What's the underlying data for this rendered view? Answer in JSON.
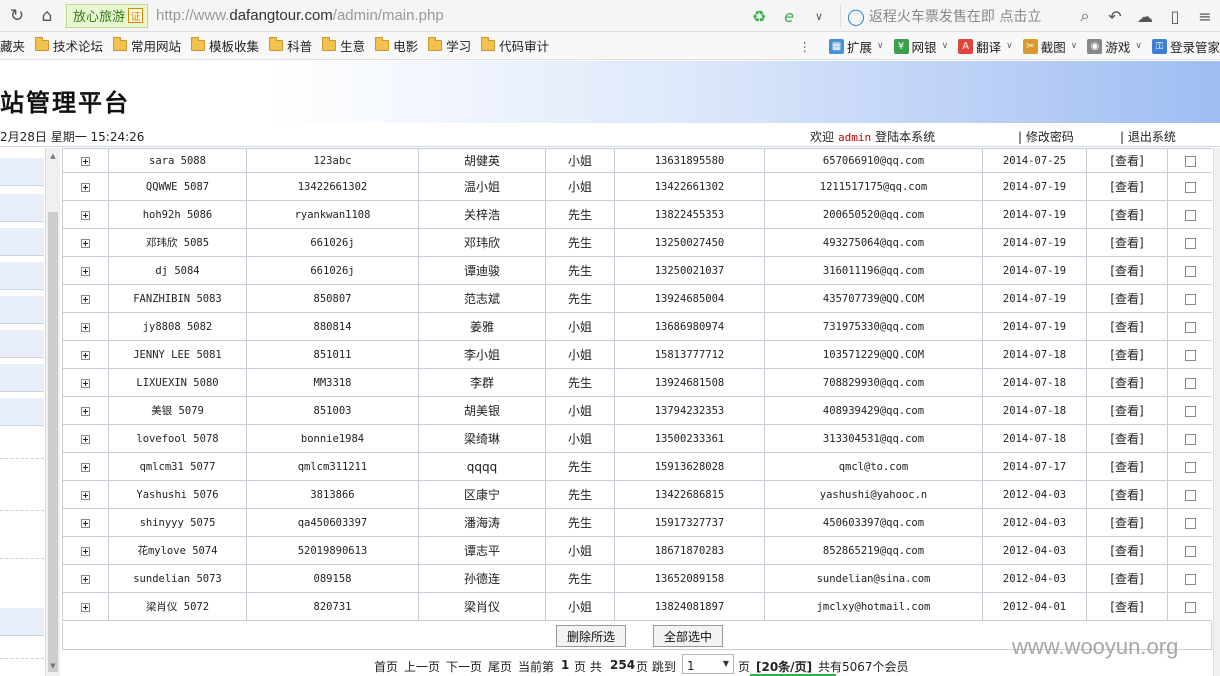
{
  "browser": {
    "site_badge": "放心旅游",
    "cert_mark": "证",
    "url_scheme": "http://www.",
    "url_host": "dafangtour.com",
    "url_path": "/admin/main.php",
    "search_text": "返程火车票发售在即 点击立",
    "bookmarks": [
      "藏夹",
      "技术论坛",
      "常用网站",
      "模板收集",
      "科普",
      "生意",
      "电影",
      "学习",
      "代码审计"
    ],
    "extensions": [
      "扩展",
      "网银",
      "翻译",
      "截图",
      "游戏",
      "登录管家"
    ]
  },
  "admin": {
    "title": "站管理平台",
    "datetime": "2月28日  星期一 15:24:26",
    "welcome_prefix": "欢迎",
    "welcome_user": "admin",
    "welcome_suffix": "登陆本系统",
    "change_password": "| 修改密码",
    "logout": "| 退出系统"
  },
  "table": {
    "view_label": "[查看]",
    "rows": [
      {
        "user": "sara 5088",
        "password": "123abc",
        "name": "胡健英",
        "title": "小姐",
        "phone": "13631895580",
        "email": "657066910@qq.com",
        "date": "2014-07-25"
      },
      {
        "user": "QQWWE 5087",
        "password": "13422661302",
        "name": "温小姐",
        "title": "小姐",
        "phone": "13422661302",
        "email": "1211517175@qq.com",
        "date": "2014-07-19"
      },
      {
        "user": "hoh92h 5086",
        "password": "ryankwan1108",
        "name": "关梓浩",
        "title": "先生",
        "phone": "13822455353",
        "email": "200650520@qq.com",
        "date": "2014-07-19"
      },
      {
        "user": "邓玮欣 5085",
        "password": "661026j",
        "name": "邓玮欣",
        "title": "先生",
        "phone": "13250027450",
        "email": "493275064@qq.com",
        "date": "2014-07-19"
      },
      {
        "user": "dj 5084",
        "password": "661026j",
        "name": "谭迪骏",
        "title": "先生",
        "phone": "13250021037",
        "email": "316011196@qq.com",
        "date": "2014-07-19"
      },
      {
        "user": "FANZHIBIN 5083",
        "password": "850807",
        "name": "范志斌",
        "title": "先生",
        "phone": "13924685004",
        "email": "435707739@QQ.COM",
        "date": "2014-07-19"
      },
      {
        "user": "jy8808 5082",
        "password": "880814",
        "name": "姜雅",
        "title": "小姐",
        "phone": "13686980974",
        "email": "731975330@qq.com",
        "date": "2014-07-19"
      },
      {
        "user": "JENNY LEE 5081",
        "password": "851011",
        "name": "李小姐",
        "title": "小姐",
        "phone": "15813777712",
        "email": "103571229@QQ.COM",
        "date": "2014-07-18"
      },
      {
        "user": "LIXUEXIN 5080",
        "password": "MM3318",
        "name": "李群",
        "title": "先生",
        "phone": "13924681508",
        "email": "708829930@qq.com",
        "date": "2014-07-18"
      },
      {
        "user": "美银 5079",
        "password": "851003",
        "name": "胡美银",
        "title": "小姐",
        "phone": "13794232353",
        "email": "408939429@qq.com",
        "date": "2014-07-18"
      },
      {
        "user": "lovefool 5078",
        "password": "bonnie1984",
        "name": "梁绮琳",
        "title": "小姐",
        "phone": "13500233361",
        "email": "313304531@qq.com",
        "date": "2014-07-18"
      },
      {
        "user": "qmlcm31 5077",
        "password": "qmlcm311211",
        "name": "qqqq",
        "title": "先生",
        "phone": "15913628028",
        "email": "qmcl@to.com",
        "date": "2014-07-17"
      },
      {
        "user": "Yashushi 5076",
        "password": "3813866",
        "name": "区康宁",
        "title": "先生",
        "phone": "13422686815",
        "email": "yashushi@yahooc.n",
        "date": "2012-04-03"
      },
      {
        "user": "shinyyy 5075",
        "password": "qa450603397",
        "name": "潘海涛",
        "title": "先生",
        "phone": "15917327737",
        "email": "450603397@qq.com",
        "date": "2012-04-03"
      },
      {
        "user": "花mylove 5074",
        "password": "52019890613",
        "name": "谭志平",
        "title": "小姐",
        "phone": "18671870283",
        "email": "852865219@qq.com",
        "date": "2012-04-03"
      },
      {
        "user": "sundelian 5073",
        "password": "089158",
        "name": "孙德连",
        "title": "先生",
        "phone": "13652089158",
        "email": "sundelian@sina.com",
        "date": "2012-04-03"
      },
      {
        "user": "梁肖仪 5072",
        "password": "820731",
        "name": "梁肖仪",
        "title": "小姐",
        "phone": "13824081897",
        "email": "jmclxy@hotmail.com",
        "date": "2012-04-01"
      }
    ]
  },
  "actions": {
    "delete_selected": "删除所选",
    "select_all": "全部选中"
  },
  "pager": {
    "first": "首页",
    "prev": "上一页",
    "next": "下一页",
    "last": "尾页",
    "current_prefix": "当前第",
    "current": "1",
    "page_word": "页 共",
    "total_pages": "254",
    "jump_prefix": "页 跳到",
    "jump_value": "1",
    "jump_suffix": "页",
    "per_page": "[20条/页]",
    "total_members": "共有5067个会员"
  },
  "watermark": "www.wooyun.org"
}
